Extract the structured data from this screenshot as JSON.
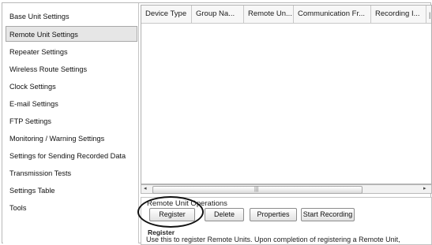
{
  "nav": {
    "items": [
      {
        "label": "Base Unit Settings"
      },
      {
        "label": "Remote Unit Settings"
      },
      {
        "label": "Repeater Settings"
      },
      {
        "label": "Wireless Route Settings"
      },
      {
        "label": "Clock Settings"
      },
      {
        "label": "E-mail Settings"
      },
      {
        "label": "FTP Settings"
      },
      {
        "label": "Monitoring / Warning Settings"
      },
      {
        "label": "Settings for Sending Recorded Data"
      },
      {
        "label": "Transmission Tests"
      },
      {
        "label": "Settings Table"
      },
      {
        "label": "Tools"
      }
    ],
    "selected": "Remote Unit Settings"
  },
  "grid": {
    "columns": [
      {
        "label": "Device Type"
      },
      {
        "label": "Group Na..."
      },
      {
        "label": "Remote Un..."
      },
      {
        "label": "Communication Fr..."
      },
      {
        "label": "Recording I..."
      }
    ],
    "rows": []
  },
  "operations": {
    "title": "Remote Unit Operations",
    "register_label": "Register",
    "delete_label": "Delete",
    "properties_label": "Properties",
    "start_recording_label": "Start Recording"
  },
  "description": {
    "title": "Register",
    "text": "Use this to register Remote Units. Upon completion of registering a Remote Unit,"
  }
}
